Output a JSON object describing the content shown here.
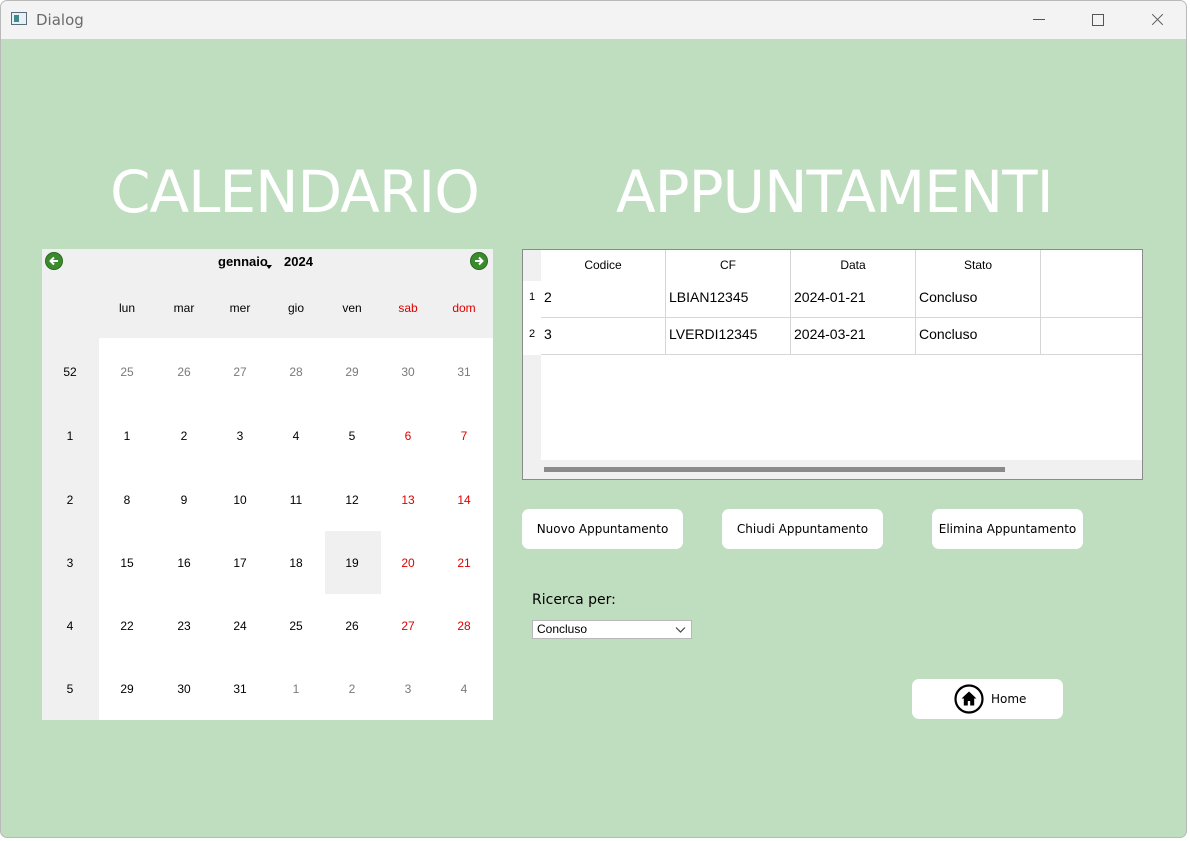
{
  "window": {
    "title": "Dialog",
    "controls": [
      "minimize",
      "maximize",
      "close"
    ]
  },
  "headings": {
    "calendar": "CALENDARIO",
    "appointments": "APPUNTAMENTI"
  },
  "calendar": {
    "month": "gennaio",
    "year": "2024",
    "prev_icon": "arrow-left-circle-icon",
    "next_icon": "arrow-right-circle-icon",
    "days_of_week": [
      "lun",
      "mar",
      "mer",
      "gio",
      "ven",
      "sab",
      "dom"
    ],
    "weeks": [
      {
        "week": "52",
        "days": [
          "25",
          "26",
          "27",
          "28",
          "29",
          "30",
          "31"
        ]
      },
      {
        "week": "1",
        "days": [
          "1",
          "2",
          "3",
          "4",
          "5",
          "6",
          "7"
        ]
      },
      {
        "week": "2",
        "days": [
          "8",
          "9",
          "10",
          "11",
          "12",
          "13",
          "14"
        ]
      },
      {
        "week": "3",
        "days": [
          "15",
          "16",
          "17",
          "18",
          "19",
          "20",
          "21"
        ]
      },
      {
        "week": "4",
        "days": [
          "22",
          "23",
          "24",
          "25",
          "26",
          "27",
          "28"
        ]
      },
      {
        "week": "5",
        "days": [
          "29",
          "30",
          "31",
          "1",
          "2",
          "3",
          "4"
        ]
      }
    ],
    "selected_day": "19",
    "weekend_color": "#e00000",
    "other_month_color": "#7a7a7a"
  },
  "table": {
    "columns": [
      "Codice",
      "CF",
      "Data",
      "Stato"
    ],
    "rows": [
      {
        "num": "1",
        "cells": [
          "2",
          "LBIAN12345",
          "2024-01-21",
          "Concluso"
        ]
      },
      {
        "num": "2",
        "cells": [
          "3",
          "LVERDI12345",
          "2024-03-21",
          "Concluso"
        ]
      }
    ]
  },
  "buttons": {
    "new": "Nuovo Appuntamento",
    "close": "Chiudi Appuntamento",
    "delete": "Elimina Appuntamento",
    "home": "Home",
    "home_icon": "home-icon"
  },
  "search": {
    "label": "Ricerca per:",
    "selected": "Concluso"
  },
  "colors": {
    "background": "#bfddbf",
    "title_text": "#ffffff"
  }
}
